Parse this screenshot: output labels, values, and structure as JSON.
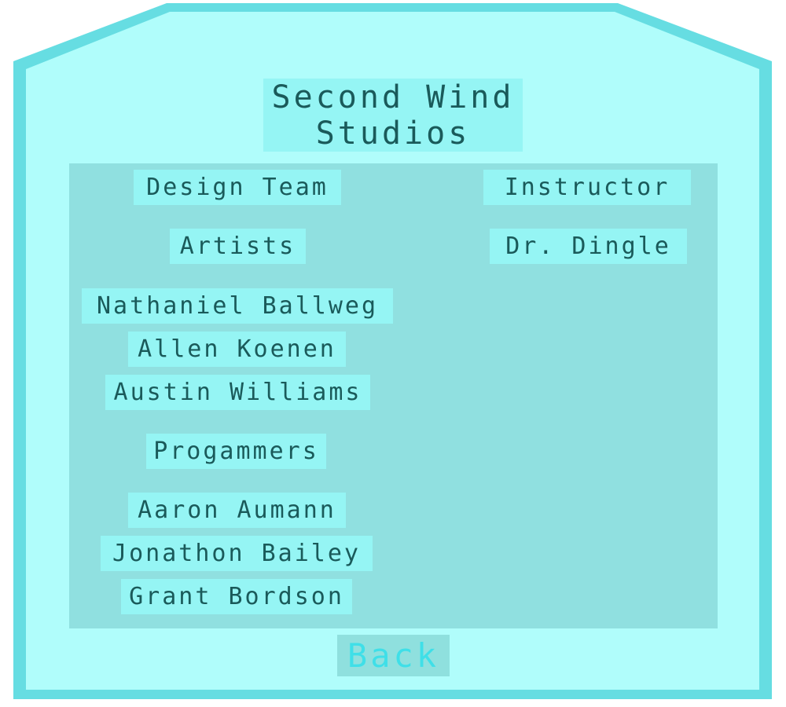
{
  "title": {
    "line1": "Second Wind",
    "line2": "Studios"
  },
  "left_column": {
    "design_team": "Design Team",
    "artists_header": "Artists",
    "artists": [
      "Nathaniel Ballweg",
      "Allen Koenen",
      "Austin Williams"
    ],
    "programmers_header": "Progammers",
    "programmers": [
      "Aaron Aumann",
      "Jonathon Bailey",
      "Grant Bordson"
    ]
  },
  "right_column": {
    "instructor_header": "Instructor",
    "instructor_name": "Dr. Dingle"
  },
  "back_button": "Back",
  "colors": {
    "frame_border": "#66dde2",
    "frame_fill": "#b0fdfb",
    "panel": "#90e0e0",
    "label_bg": "#95f5f4",
    "label_text": "#1a5a5a",
    "back_text": "#3fdfe8"
  }
}
